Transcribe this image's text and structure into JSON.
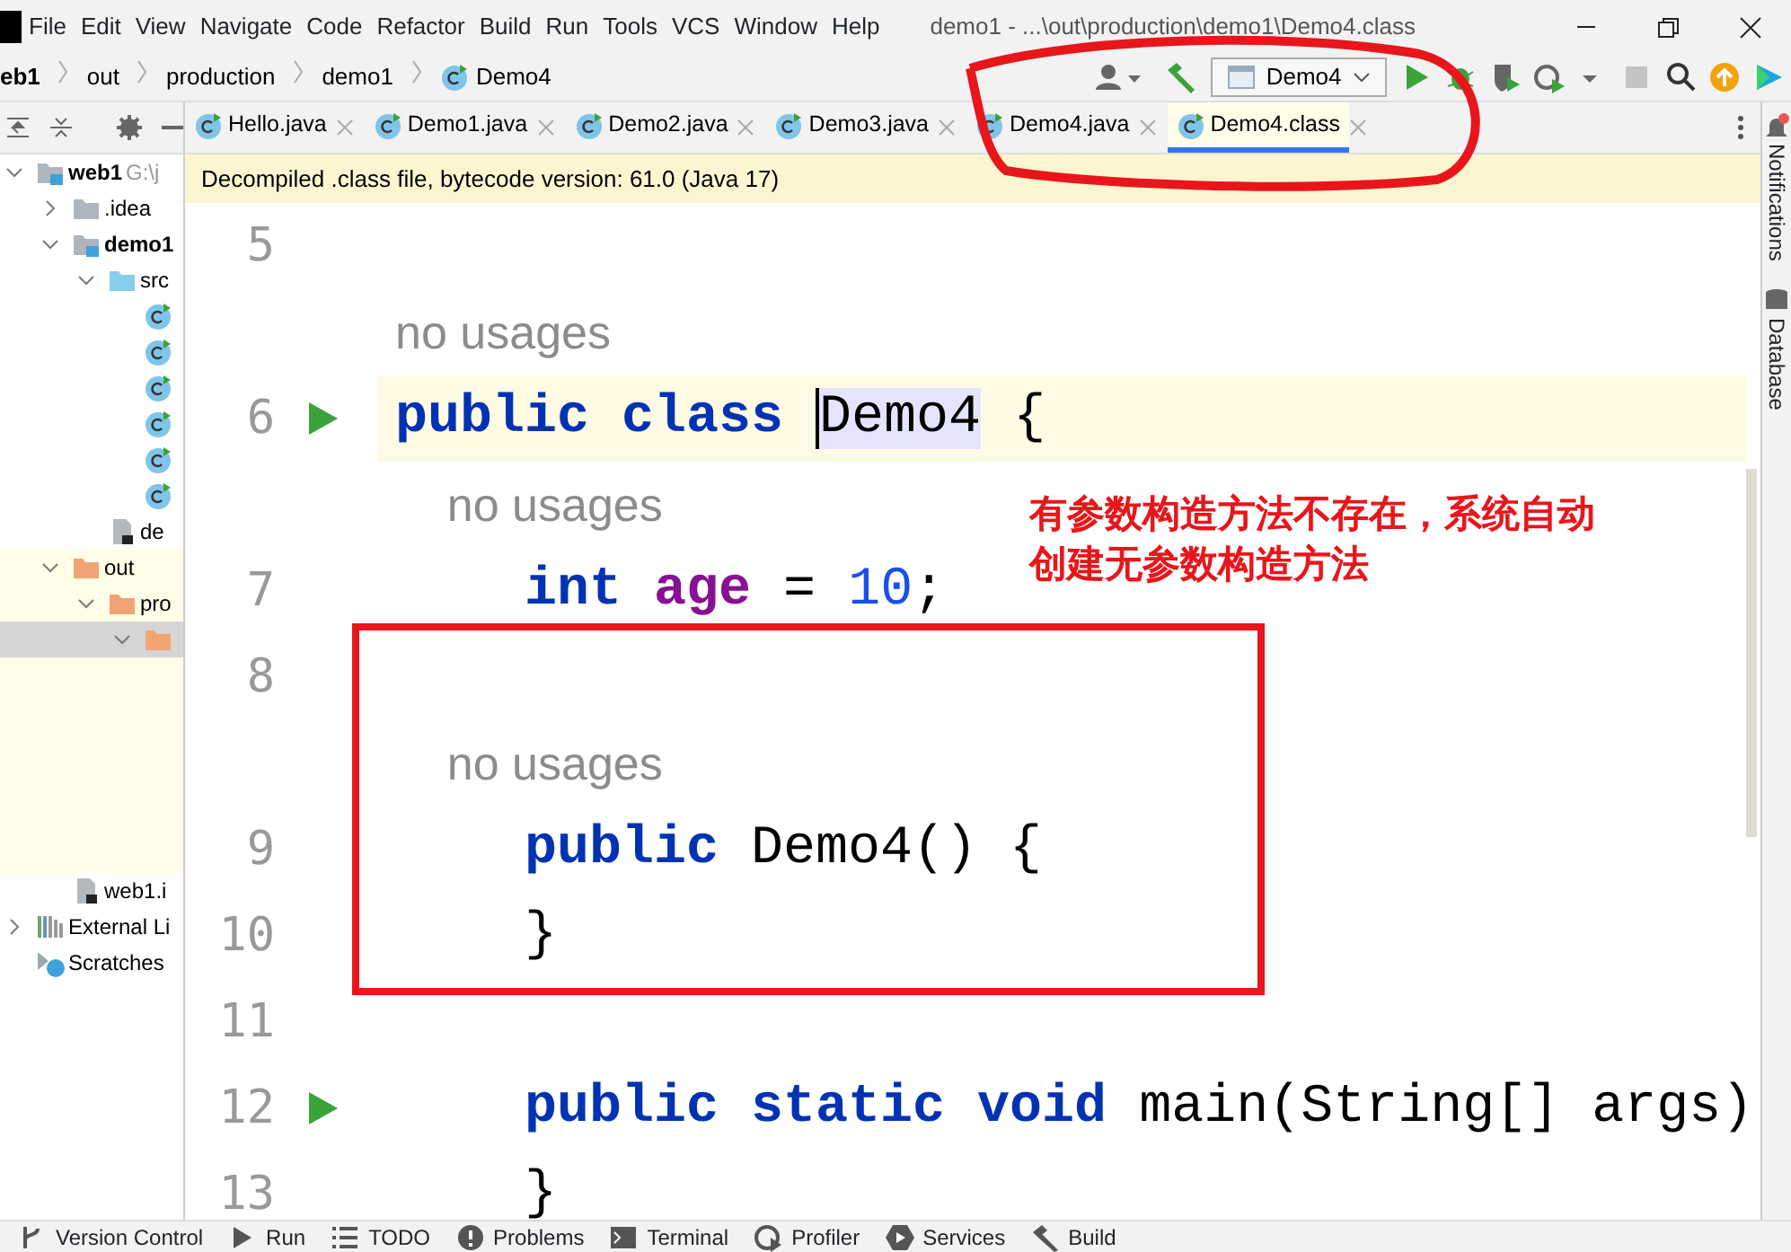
{
  "menu": [
    "File",
    "Edit",
    "View",
    "Navigate",
    "Code",
    "Refactor",
    "Build",
    "Run",
    "Tools",
    "VCS",
    "Window",
    "Help"
  ],
  "window": {
    "title": "demo1 - ...\\out\\production\\demo1\\Demo4.class"
  },
  "breadcrumb": [
    {
      "label": "eb1",
      "kind": "module"
    },
    {
      "label": "out",
      "kind": "folder"
    },
    {
      "label": "production",
      "kind": "folder"
    },
    {
      "label": "demo1",
      "kind": "folder"
    },
    {
      "label": "Demo4",
      "kind": "class"
    }
  ],
  "run_config": {
    "label": "Demo4"
  },
  "tabs": [
    {
      "label": "Hello.java",
      "selected": false
    },
    {
      "label": "Demo1.java",
      "selected": false
    },
    {
      "label": "Demo2.java",
      "selected": false
    },
    {
      "label": "Demo3.java",
      "selected": false
    },
    {
      "label": "Demo4.java",
      "selected": false
    },
    {
      "label": "Demo4.class",
      "selected": true
    }
  ],
  "banner": "Decompiled .class file, bytecode version: 61.0 (Java 17)",
  "project_tree": [
    {
      "label": "web1",
      "note": "G:\\j",
      "kind": "module",
      "expanded": true,
      "children": [
        {
          "label": ".idea",
          "kind": "folder",
          "expanded": false
        },
        {
          "label": "demo1",
          "kind": "module",
          "expanded": true,
          "children": [
            {
              "label": "src",
              "kind": "source",
              "expanded": true,
              "children": [
                {
                  "kind": "class"
                },
                {
                  "kind": "class"
                },
                {
                  "kind": "class"
                },
                {
                  "kind": "class"
                },
                {
                  "kind": "class"
                },
                {
                  "kind": "class"
                }
              ]
            },
            {
              "label": "de",
              "kind": "iml"
            }
          ]
        },
        {
          "label": "out",
          "kind": "excluded",
          "expanded": true,
          "children": [
            {
              "label": "pro",
              "kind": "excluded",
              "expanded": true,
              "children": [
                {
                  "kind": "excluded",
                  "expanded": true,
                  "selected": true
                }
              ]
            }
          ]
        },
        {
          "label": "web1.i",
          "kind": "iml"
        }
      ]
    },
    {
      "label": "External Li",
      "kind": "library",
      "expanded": false
    },
    {
      "label": "Scratches",
      "kind": "scratch"
    }
  ],
  "editor": {
    "rows": [
      {
        "kind": "code",
        "number": "5",
        "tokens": []
      },
      {
        "kind": "inlay",
        "text": "no usages"
      },
      {
        "kind": "code",
        "number": "6",
        "run": true,
        "current": true,
        "tokens": [
          {
            "text": "public class ",
            "kind": "keyword"
          },
          {
            "text": "Demo4",
            "kind": "highlight"
          },
          {
            "text": " {",
            "kind": "plain"
          }
        ]
      },
      {
        "kind": "inlay",
        "text": "    no usages"
      },
      {
        "kind": "code",
        "number": "7",
        "tokens": [
          {
            "text": "    int ",
            "kind": "keyword"
          },
          {
            "text": "age",
            "kind": "field"
          },
          {
            "text": " = ",
            "kind": "plain"
          },
          {
            "text": "10",
            "kind": "number"
          },
          {
            "text": ";",
            "kind": "plain"
          }
        ]
      },
      {
        "kind": "code",
        "number": "8",
        "tokens": []
      },
      {
        "kind": "inlay",
        "text": "    no usages"
      },
      {
        "kind": "code",
        "number": "9",
        "tokens": [
          {
            "text": "    public",
            "kind": "keyword"
          },
          {
            "text": " Demo4() {",
            "kind": "plain"
          }
        ]
      },
      {
        "kind": "code",
        "number": "10",
        "tokens": [
          {
            "text": "    }",
            "kind": "plain"
          }
        ]
      },
      {
        "kind": "code",
        "number": "11",
        "tokens": []
      },
      {
        "kind": "code",
        "number": "12",
        "run": true,
        "tokens": [
          {
            "text": "    public static void",
            "kind": "keyword"
          },
          {
            "text": " main(String[] args)",
            "kind": "plain"
          }
        ]
      },
      {
        "kind": "code",
        "number": "13",
        "tokens": [
          {
            "text": "    }",
            "kind": "plain"
          }
        ]
      }
    ]
  },
  "annotation": {
    "lines": [
      "有参数构造方法不存在，系统自动",
      "创建无参数构造方法"
    ]
  },
  "right_strip": [
    "Notifications",
    "Database"
  ],
  "status_bar": [
    {
      "label": "Version Control",
      "kind": "branch"
    },
    {
      "label": "Run",
      "kind": "run"
    },
    {
      "label": "TODO",
      "kind": "list"
    },
    {
      "label": "Problems",
      "kind": "problems"
    },
    {
      "label": "Terminal",
      "kind": "terminal"
    },
    {
      "label": "Profiler",
      "kind": "profiler"
    },
    {
      "label": "Services",
      "kind": "services"
    },
    {
      "label": "Build",
      "kind": "hammer"
    }
  ]
}
